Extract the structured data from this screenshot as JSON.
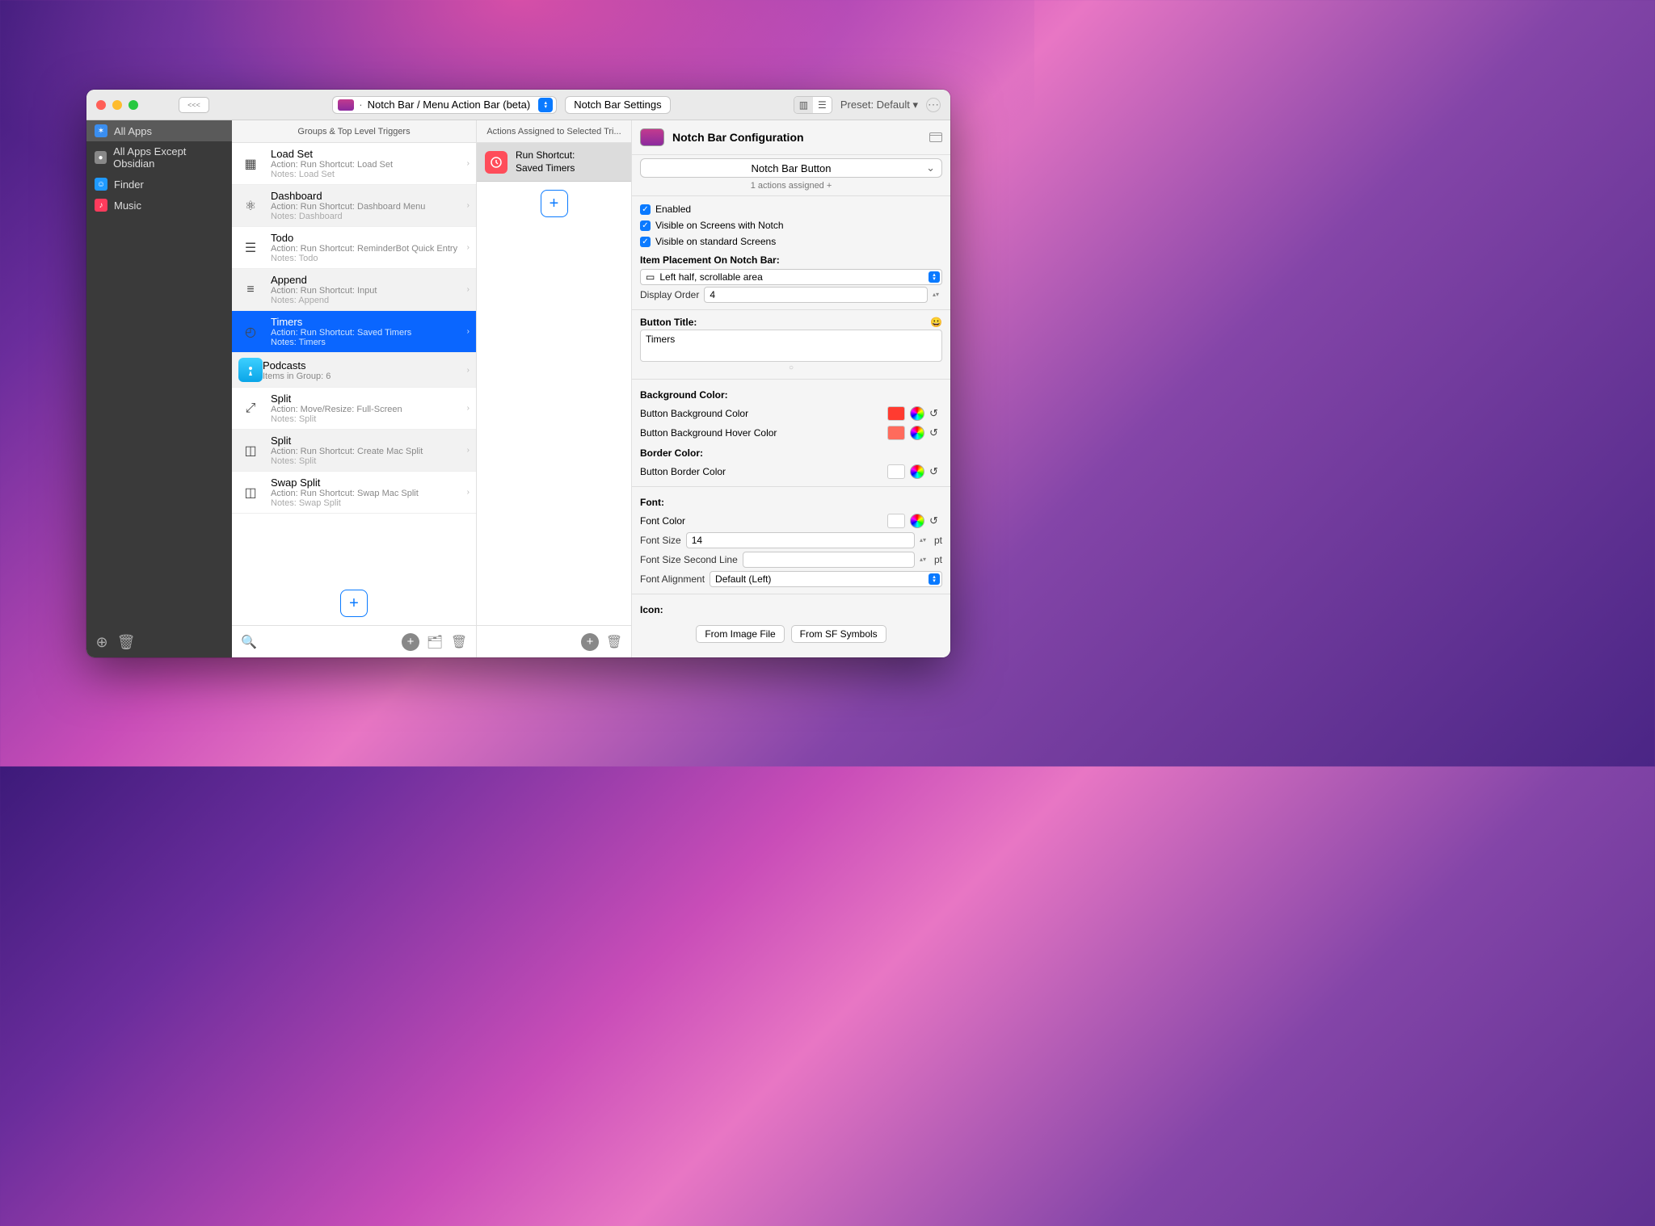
{
  "titlebar": {
    "back": "<<<",
    "selector_label": "Notch Bar / Menu Action Bar (beta)",
    "settings_btn": "Notch Bar Settings",
    "preset": "Preset: Default ▾"
  },
  "sidebar": {
    "items": [
      {
        "label": "All Apps",
        "color": "#3a8ef0",
        "glyph": "✶",
        "selected": true
      },
      {
        "label": "All Apps Except Obsidian",
        "color": "#888",
        "glyph": "●"
      },
      {
        "label": "Finder",
        "color": "#1f9aff",
        "glyph": "☺"
      },
      {
        "label": "Music",
        "color": "#ff3b5c",
        "glyph": "♪"
      }
    ]
  },
  "groups": {
    "title": "Groups & Top Level Triggers",
    "items": [
      {
        "title": "Load Set",
        "sub": "Action: Run Shortcut: Load Set",
        "notes": "Notes: Load Set",
        "icon": "▦",
        "alt": false
      },
      {
        "title": "Dashboard",
        "sub": "Action: Run Shortcut: Dashboard Menu",
        "notes": "Notes: Dashboard",
        "icon": "⚛",
        "alt": true
      },
      {
        "title": "Todo",
        "sub": "Action: Run Shortcut: ReminderBot Quick Entry",
        "notes": "Notes: Todo",
        "icon": "☰",
        "alt": false
      },
      {
        "title": "Append",
        "sub": "Action: Run Shortcut: Input",
        "notes": "Notes: Append",
        "icon": "≡",
        "alt": true
      },
      {
        "title": "Timers",
        "sub": "Action: Run Shortcut: Saved Timers",
        "notes": "Notes: Timers",
        "icon": "◴",
        "alt": false,
        "selected": true
      },
      {
        "title": "Podcasts",
        "sub": "Items in Group: 6",
        "notes": "",
        "icon": "podcast",
        "alt": true
      },
      {
        "title": "Split",
        "sub": "Action: Move/Resize: Full-Screen",
        "notes": "Notes: Split",
        "icon": "⤢",
        "alt": false
      },
      {
        "title": "Split",
        "sub": "Action: Run Shortcut: Create Mac Split",
        "notes": "Notes: Split",
        "icon": "◫",
        "alt": true
      },
      {
        "title": "Swap Split",
        "sub": "Action: Run Shortcut: Swap Mac Split",
        "notes": "Notes: Swap Split",
        "icon": "◫",
        "alt": false
      }
    ]
  },
  "actions": {
    "title": "Actions Assigned to Selected Tri...",
    "items": [
      {
        "line1": "Run Shortcut:",
        "line2": "Saved Timers"
      }
    ]
  },
  "inspector": {
    "title": "Notch Bar Configuration",
    "type_selector": "Notch Bar Button",
    "meta": "1 actions assigned +",
    "check_enabled": "Enabled",
    "check_notch": "Visible on Screens with Notch",
    "check_standard": "Visible on standard Screens",
    "placement_label": "Item Placement On Notch Bar:",
    "placement_value": "Left half, scrollable area",
    "display_order_label": "Display Order",
    "display_order_value": "4",
    "button_title_label": "Button Title:",
    "button_title_value": "Timers",
    "bg_section": "Background Color:",
    "bg_color_label": "Button Background Color",
    "bg_hover_label": "Button Background Hover Color",
    "border_section": "Border Color:",
    "border_color_label": "Button Border Color",
    "font_section": "Font:",
    "font_color_label": "Font Color",
    "font_size_label": "Font Size",
    "font_size_value": "14",
    "font_size2_label": "Font Size Second Line",
    "font_align_label": "Font Alignment",
    "font_align_value": "Default (Left)",
    "icon_section": "Icon:",
    "from_file": "From Image File",
    "from_sf": "From SF Symbols",
    "pt": "pt",
    "colors": {
      "bg": "#ff3b30",
      "bg_hover": "#ff6b5c",
      "border": "#ffffff",
      "font": "#ffffff"
    }
  }
}
